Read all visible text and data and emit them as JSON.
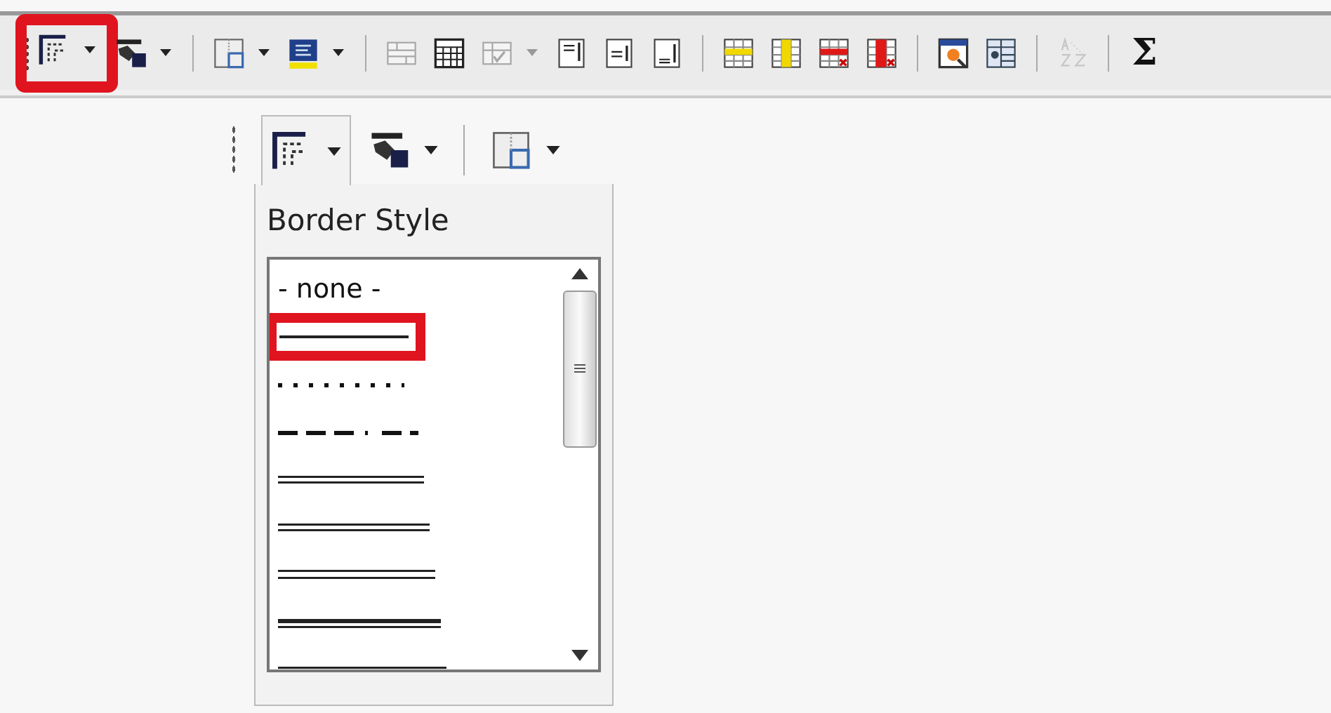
{
  "toolbar": {
    "items": [
      {
        "kind": "button",
        "dropdown": true,
        "disabled": false,
        "annotated": true
      },
      {
        "kind": "button",
        "dropdown": true,
        "disabled": false,
        "annotated": false
      },
      {
        "kind": "separator"
      },
      {
        "kind": "button",
        "dropdown": true,
        "disabled": false,
        "annotated": false
      },
      {
        "kind": "button",
        "dropdown": true,
        "disabled": false,
        "annotated": false
      },
      {
        "kind": "separator"
      },
      {
        "kind": "button",
        "dropdown": false,
        "disabled": true,
        "annotated": false
      },
      {
        "kind": "button",
        "dropdown": false,
        "disabled": false,
        "annotated": false
      },
      {
        "kind": "button",
        "dropdown": true,
        "disabled": true,
        "annotated": false
      },
      {
        "kind": "button",
        "dropdown": false,
        "disabled": false,
        "annotated": false
      },
      {
        "kind": "button",
        "dropdown": false,
        "disabled": false,
        "annotated": false
      },
      {
        "kind": "button",
        "dropdown": false,
        "disabled": false,
        "annotated": false
      },
      {
        "kind": "separator"
      },
      {
        "kind": "button",
        "dropdown": false,
        "disabled": false,
        "annotated": false
      },
      {
        "kind": "button",
        "dropdown": false,
        "disabled": false,
        "annotated": false
      },
      {
        "kind": "button",
        "dropdown": false,
        "disabled": false,
        "annotated": false
      },
      {
        "kind": "button",
        "dropdown": false,
        "disabled": false,
        "annotated": false
      },
      {
        "kind": "separator"
      },
      {
        "kind": "button",
        "dropdown": false,
        "disabled": false,
        "annotated": false
      },
      {
        "kind": "button",
        "dropdown": false,
        "disabled": false,
        "annotated": false
      },
      {
        "kind": "separator"
      },
      {
        "kind": "button",
        "dropdown": false,
        "disabled": true,
        "annotated": false
      },
      {
        "kind": "separator"
      },
      {
        "kind": "text",
        "label": "Σ",
        "disabled": false,
        "annotated": false
      }
    ]
  },
  "popup": {
    "buttons": [
      {
        "dropdown": true,
        "selected": true
      },
      {
        "dropdown": true,
        "selected": false
      },
      {
        "dropdown": true,
        "selected": false
      }
    ],
    "title": "Border Style",
    "styles": [
      {
        "kind": "text",
        "label": "- none -",
        "annotated": false
      },
      {
        "kind": "line",
        "annotated": true
      },
      {
        "kind": "line",
        "annotated": false
      },
      {
        "kind": "line",
        "annotated": false
      },
      {
        "kind": "line",
        "annotated": false
      },
      {
        "kind": "line",
        "annotated": false
      },
      {
        "kind": "line",
        "annotated": false
      },
      {
        "kind": "line",
        "annotated": false
      },
      {
        "kind": "line",
        "annotated": false
      }
    ]
  }
}
